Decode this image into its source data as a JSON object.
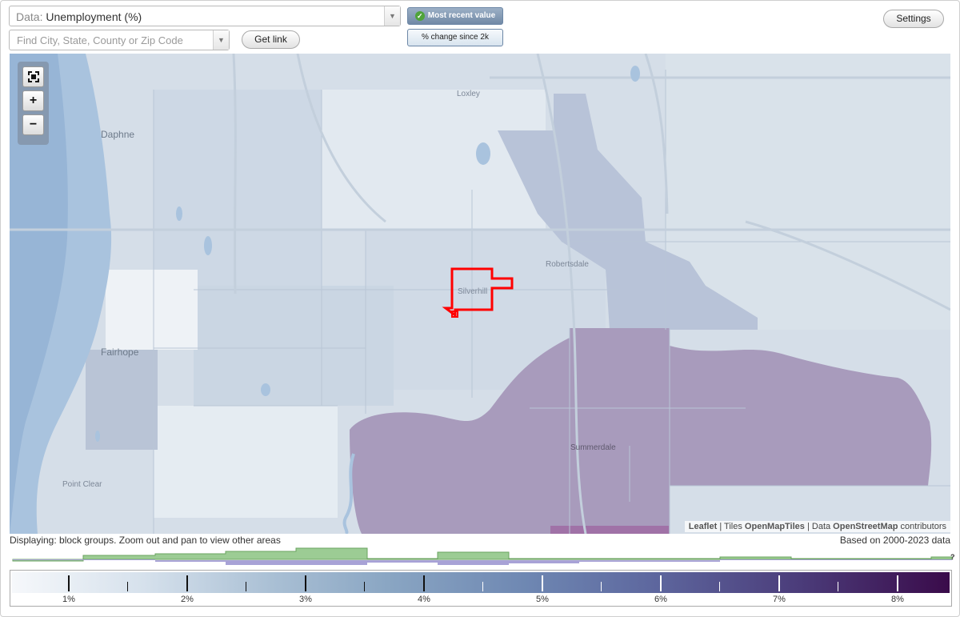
{
  "controls": {
    "data_prefix": "Data:",
    "data_value": "Unemployment (%)",
    "search_placeholder": "Find City, State, County or Zip Code",
    "get_link": "Get link",
    "most_recent": "Most recent value",
    "pct_change": "% change since 2k",
    "settings": "Settings"
  },
  "map": {
    "zoom_fit_icon": "fullscreen-icon",
    "zoom_in": "+",
    "zoom_out": "−",
    "places": {
      "loxley": "Loxley",
      "daphne": "Daphne",
      "robertsdale": "Robertsdale",
      "silverhill": "Silverhill",
      "fairhope": "Fairhope",
      "summerdale": "Summerdale",
      "point_clear": "Point Clear"
    },
    "attribution": {
      "leaflet": "Leaflet",
      "sep1": " | Tiles ",
      "tiles": "OpenMapTiles",
      "sep2": " | Data ",
      "data": "OpenStreetMap",
      "tail": " contributors"
    },
    "colors": {
      "water": "#a9c3de",
      "low": "#e8eef4",
      "mid": "#cbd8e5",
      "mid2": "#bfcde0",
      "high": "#a89bbc",
      "highlight": "#ff0000"
    }
  },
  "status": {
    "displaying": "Displaying: block groups. Zoom out and pan to view other areas",
    "based_on": "Based on 2000-2023 data"
  },
  "legend": {
    "labels": [
      "1%",
      "2%",
      "3%",
      "4%",
      "5%",
      "6%",
      "7%",
      "8%"
    ],
    "help": "?"
  }
}
